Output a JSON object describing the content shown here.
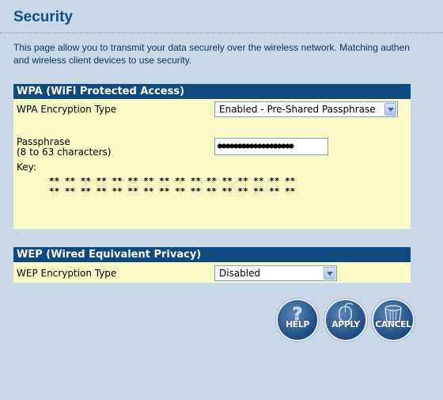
{
  "page": {
    "title": "Security",
    "intro_line1": "This page allow you to transmit your data securely over the wireless network. Matching authen",
    "intro_line2": "and wireless client devices to use security."
  },
  "wpa": {
    "header": "WPA (WiFi Protected Access)",
    "encryption_label": "WPA Encryption Type",
    "encryption_value": "Enabled - Pre-Shared Passphrase",
    "passphrase_label": "Passphrase",
    "passphrase_hint": "(8 to 63 characters)",
    "passphrase_value": "●●●●●●●●●●●●●●●●●●●",
    "key_label": "Key:",
    "key_line1": "** ** ** ** ** ** ** ** ** ** ** ** ** ** ** **",
    "key_line2": "** ** ** ** ** ** ** ** ** ** ** ** ** ** ** **"
  },
  "wep": {
    "header": "WEP (Wired Equivalent Privacy)",
    "encryption_label": "WEP Encryption Type",
    "encryption_value": "Disabled"
  },
  "buttons": {
    "help": {
      "label": "HELP",
      "icon": "question-icon"
    },
    "apply": {
      "label": "APPLY",
      "icon": "mouse-icon"
    },
    "cancel": {
      "label": "CANCEL",
      "icon": "trash-icon"
    }
  },
  "colors": {
    "background": "#c9d8e6",
    "title": "#0d4f8b",
    "section_header": "#0e4a7d",
    "panel": "#fafac7",
    "button": "#1e4c80"
  }
}
